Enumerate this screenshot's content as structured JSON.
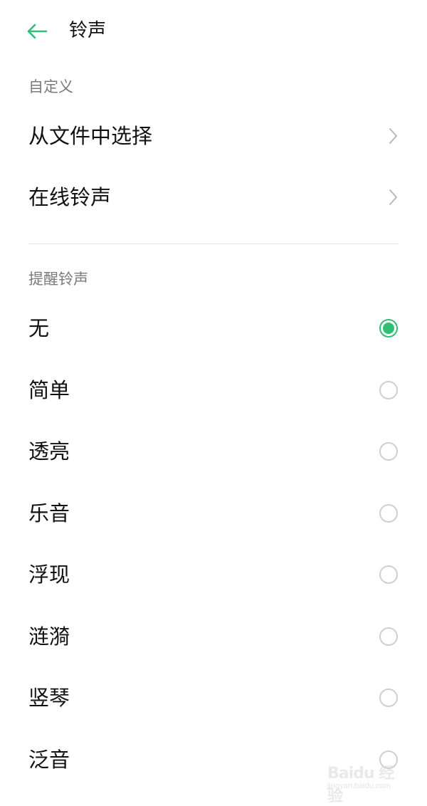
{
  "header": {
    "back_icon": "arrow-left-icon",
    "title": "铃声",
    "accent_color": "#2ebf74"
  },
  "custom_section": {
    "label": "自定义",
    "items": [
      {
        "label": "从文件中选择",
        "icon": "chevron-right-icon"
      },
      {
        "label": "在线铃声",
        "icon": "chevron-right-icon"
      }
    ]
  },
  "alert_section": {
    "label": "提醒铃声",
    "selected": "无",
    "options": [
      {
        "label": "无",
        "checked": true
      },
      {
        "label": "简单",
        "checked": false
      },
      {
        "label": "透亮",
        "checked": false
      },
      {
        "label": "乐音",
        "checked": false
      },
      {
        "label": "浮现",
        "checked": false
      },
      {
        "label": "涟漪",
        "checked": false
      },
      {
        "label": "竖琴",
        "checked": false
      },
      {
        "label": "泛音",
        "checked": false
      }
    ]
  },
  "watermark": {
    "main": "Baidu 经验",
    "sub": "jingyan.baidu.com"
  }
}
